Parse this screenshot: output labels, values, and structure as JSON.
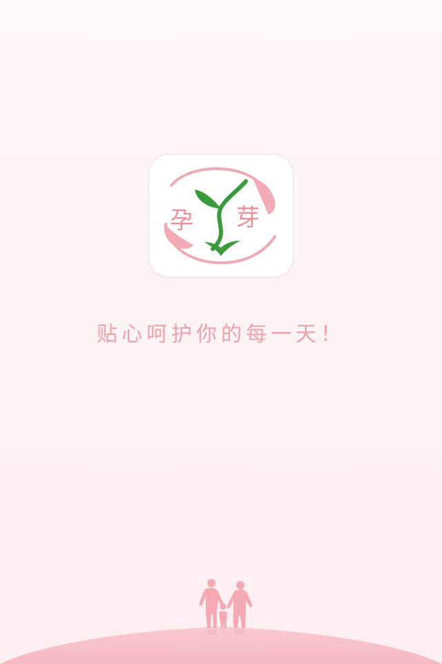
{
  "app_icon": {
    "char_left": "孕",
    "char_right": "芽"
  },
  "tagline": "贴心呵护你的每一天！",
  "colors": {
    "background": "#fdf4f6",
    "accent_pink": "#ef8d99",
    "leaf_green": "#3b9a3b",
    "hill_pink": "#f7c2cb"
  }
}
